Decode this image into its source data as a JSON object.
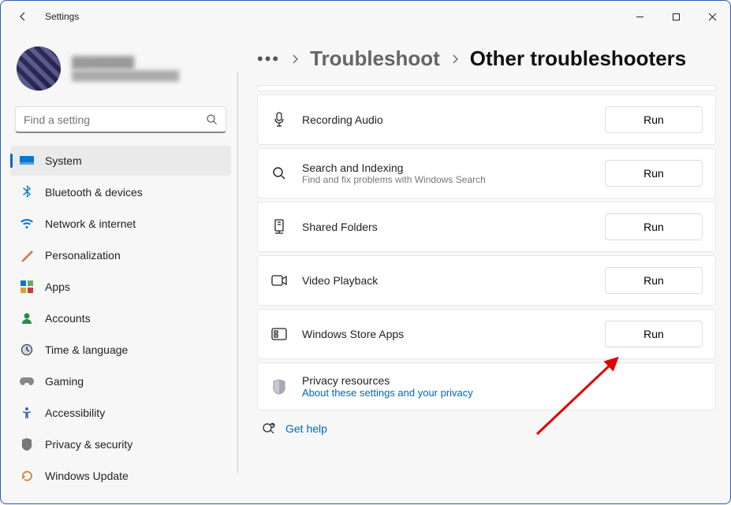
{
  "window": {
    "title": "Settings"
  },
  "user": {
    "name": "████████",
    "email": "████████████████"
  },
  "search": {
    "placeholder": "Find a setting"
  },
  "sidebar": {
    "items": [
      {
        "label": "System",
        "icon": "system"
      },
      {
        "label": "Bluetooth & devices",
        "icon": "bluetooth"
      },
      {
        "label": "Network & internet",
        "icon": "network"
      },
      {
        "label": "Personalization",
        "icon": "personalization"
      },
      {
        "label": "Apps",
        "icon": "apps"
      },
      {
        "label": "Accounts",
        "icon": "accounts"
      },
      {
        "label": "Time & language",
        "icon": "time"
      },
      {
        "label": "Gaming",
        "icon": "gaming"
      },
      {
        "label": "Accessibility",
        "icon": "accessibility"
      },
      {
        "label": "Privacy & security",
        "icon": "privacy"
      },
      {
        "label": "Windows Update",
        "icon": "update"
      }
    ]
  },
  "breadcrumb": {
    "parent": "Troubleshoot",
    "current": "Other troubleshooters"
  },
  "troubleshooters": [
    {
      "title": "Recording Audio",
      "desc": "",
      "run": "Run"
    },
    {
      "title": "Search and Indexing",
      "desc": "Find and fix problems with Windows Search",
      "run": "Run"
    },
    {
      "title": "Shared Folders",
      "desc": "",
      "run": "Run"
    },
    {
      "title": "Video Playback",
      "desc": "",
      "run": "Run"
    },
    {
      "title": "Windows Store Apps",
      "desc": "",
      "run": "Run"
    }
  ],
  "privacy": {
    "title": "Privacy resources",
    "link": "About these settings and your privacy"
  },
  "help": {
    "label": "Get help"
  }
}
